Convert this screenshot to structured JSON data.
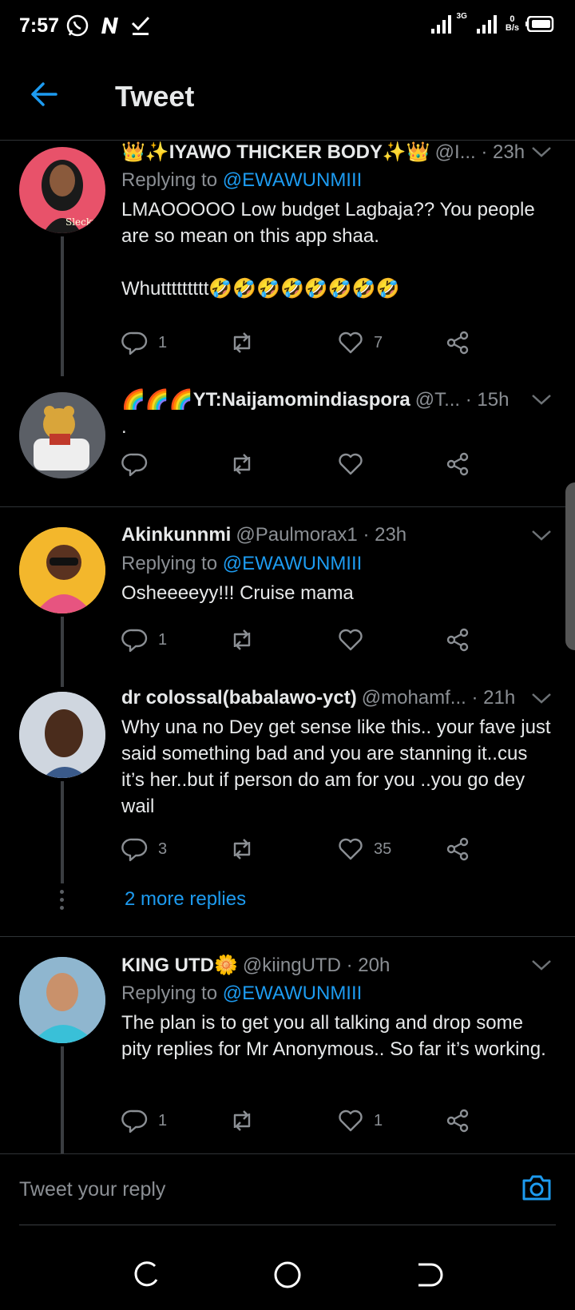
{
  "status_bar": {
    "time": "7:57",
    "net_speed_top": "0",
    "net_speed_bottom": "B/s",
    "network": "3G"
  },
  "header": {
    "title": "Tweet"
  },
  "tweets": [
    {
      "name": "👑✨IYAWO THICKER BODY✨👑",
      "meta": "@I... · 23h",
      "replying_prefix": "Replying to ",
      "replying_to": "@EWAWUNMIII",
      "text": "LMAOOOOO Low budget Lagbaja?? You people are so mean on this app shaa.\n\nWhuttttttttt🤣🤣🤣🤣🤣🤣🤣🤣",
      "replies": "1",
      "retweets": "",
      "likes": "7"
    },
    {
      "name": "🌈🌈🌈YT:Naijamomindiaspora",
      "meta": "@T... · 15h",
      "text": ".",
      "replies": "",
      "retweets": "",
      "likes": ""
    },
    {
      "name": "Akinkunnmi",
      "meta": "@Paulmorax1 · 23h",
      "replying_prefix": "Replying to ",
      "replying_to": "@EWAWUNMIII",
      "text": "Osheeeeyy!!! Cruise mama",
      "replies": "1",
      "retweets": "",
      "likes": ""
    },
    {
      "name": "dr colossal(babalawo-yct)",
      "meta": "@mohamf... · 21h",
      "text": "Why una no Dey get sense like this.. your fave just said something bad and you are stanning it..cus it’s her..but if person do am for you ..you go dey wail",
      "replies": "3",
      "retweets": "",
      "likes": "35",
      "more_replies": "2 more replies"
    },
    {
      "name": "KING UTD🌼",
      "meta": "@kiingUTD · 20h",
      "replying_prefix": "Replying to ",
      "replying_to": "@EWAWUNMIII",
      "text": "The plan is to get you all talking and drop some pity replies for Mr Anonymous.. So far it’s working.",
      "replies": "1",
      "retweets": "",
      "likes": "1"
    }
  ],
  "reply_bar": {
    "placeholder": "Tweet your reply"
  },
  "colors": {
    "accent": "#1d9bf0",
    "background": "#000000",
    "muted": "#8b8f94",
    "text": "#e7e9ea"
  },
  "icons": [
    "back-arrow-icon",
    "reply-icon",
    "retweet-icon",
    "like-icon",
    "share-icon",
    "chevron-down-icon",
    "camera-icon"
  ]
}
